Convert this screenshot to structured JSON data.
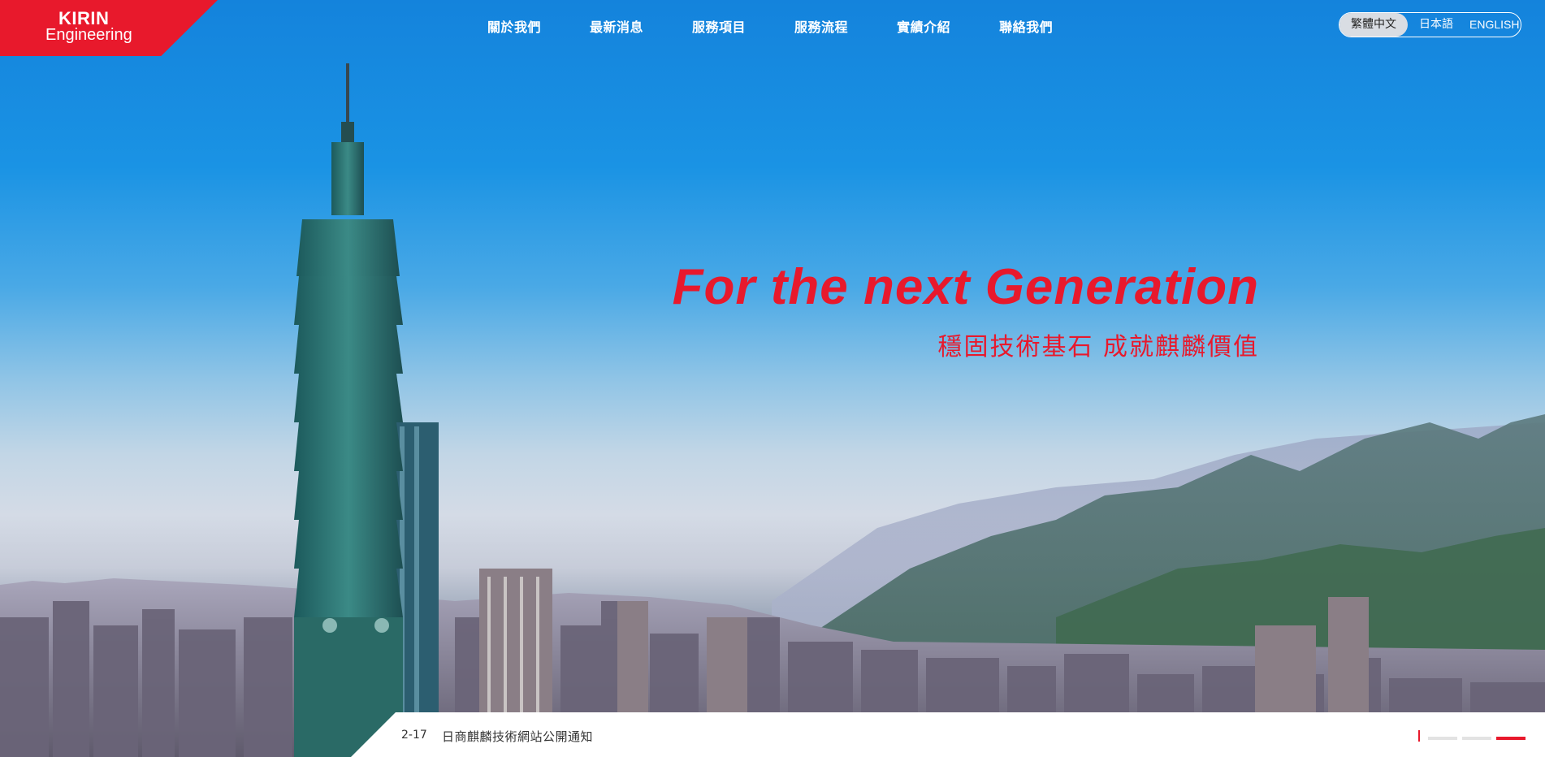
{
  "brand": {
    "line1": "KIRIN",
    "line2": "Engineering",
    "color": "#e8192c"
  },
  "nav": [
    {
      "label": "關於我們"
    },
    {
      "label": "最新消息"
    },
    {
      "label": "服務項目"
    },
    {
      "label": "服務流程"
    },
    {
      "label": "實績介紹"
    },
    {
      "label": "聯絡我們"
    }
  ],
  "languages": [
    {
      "label": "繁體中文",
      "active": true
    },
    {
      "label": "日本語",
      "active": false
    },
    {
      "label": "ENGLISH",
      "active": false
    }
  ],
  "hero": {
    "headline": "For the next Generation",
    "subline": "穩固技術基石 成就麒麟價值",
    "image": "taipei-skyline-taipei101-mountains"
  },
  "news": {
    "date": "2-17",
    "title": "日商麒麟技術網站公開通知"
  },
  "pager": {
    "slides": 3,
    "active": 3
  },
  "colors": {
    "accent": "#e8192c",
    "sky": "#1a8ee0"
  }
}
